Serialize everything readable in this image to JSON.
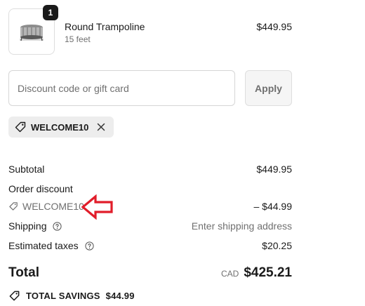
{
  "product": {
    "quantity": "1",
    "name": "Round Trampoline",
    "variant": "15 feet",
    "price": "$449.95",
    "image_icon": "trampoline-image"
  },
  "discount": {
    "placeholder": "Discount code or gift card",
    "apply_label": "Apply",
    "applied_code": "WELCOME10"
  },
  "summary": {
    "subtotal_label": "Subtotal",
    "subtotal_value": "$449.95",
    "order_discount_label": "Order discount",
    "discount_code": "WELCOME10",
    "discount_value": "– $44.99",
    "shipping_label": "Shipping",
    "shipping_value": "Enter shipping address",
    "taxes_label": "Estimated taxes",
    "taxes_value": "$20.25"
  },
  "total": {
    "label": "Total",
    "currency": "CAD",
    "amount": "$425.21"
  },
  "savings": {
    "label": "TOTAL SAVINGS",
    "amount": "$44.99"
  },
  "colors": {
    "annotation_arrow": "#e11d2a",
    "muted_text": "#707070",
    "chip_bg": "#ededed"
  }
}
